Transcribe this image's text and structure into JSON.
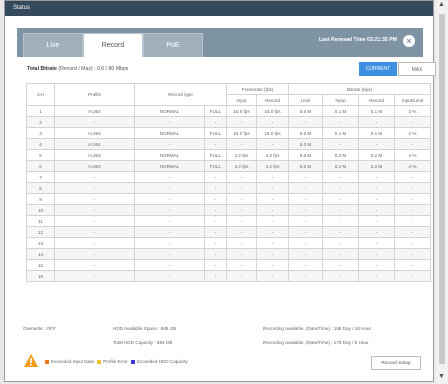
{
  "window": {
    "title": "Status"
  },
  "tabs": [
    {
      "label": "Live"
    },
    {
      "label": "Record"
    },
    {
      "label": "PoE"
    }
  ],
  "header": {
    "last_time": "Last Renewal Time 03:21:35 PM",
    "close_icon": "close-icon",
    "tab_bg_color": "#7e94a3"
  },
  "bitrate": {
    "label": "Total Bitrate",
    "detail": "(Record / Max) : 0.6 / 80 Mbps"
  },
  "toggle": {
    "current": "CURRENT",
    "max": "MAX",
    "accent": "#3d8fe0"
  },
  "table": {
    "headers": {
      "ch": "CH",
      "profile": "Profile",
      "record_type": "Record type",
      "framerate": "Framerate (fps)",
      "bitrate": "Bitrate (bps)",
      "input": "Input",
      "record": "Record",
      "limit": "Limit",
      "input_b": "Input",
      "record_b": "Record",
      "input_limit": "Input/Limit"
    },
    "rows": [
      [
        "1",
        "H.264",
        "NORMAL",
        "FULL",
        "15.0 fps",
        "15.0 fps",
        "5.0 M",
        "0.1 M",
        "0.1 M",
        "2 %"
      ],
      [
        "2",
        "-",
        "-",
        "-",
        "-",
        "-",
        "-",
        "-",
        "-",
        "-"
      ],
      [
        "3",
        "H.264",
        "NORMAL",
        "FULL",
        "15.0 fps",
        "15.0 fps",
        "5.0 M",
        "0.1 M",
        "0.1 M",
        "2 %"
      ],
      [
        "4",
        "H.264",
        "-",
        "-",
        "-",
        "-",
        "5.0 M",
        "-",
        "-",
        "-"
      ],
      [
        "5",
        "H.264",
        "NORMAL",
        "FULL",
        "4.2 fps",
        "4.2 fps",
        "5.0 M",
        "0.2 M",
        "0.2 M",
        "4 %"
      ],
      [
        "6",
        "H.264",
        "NORMAL",
        "FULL",
        "4.2 fps",
        "4.2 fps",
        "5.0 M",
        "0.2 M",
        "0.2 M",
        "4 %"
      ],
      [
        "7",
        "-",
        "-",
        "-",
        "-",
        "-",
        "-",
        "-",
        "-",
        "-"
      ],
      [
        "8",
        "-",
        "-",
        "-",
        "-",
        "-",
        "-",
        "-",
        "-",
        "-"
      ],
      [
        "9",
        "-",
        "-",
        "-",
        "-",
        "-",
        "-",
        "-",
        "-",
        "-"
      ],
      [
        "10",
        "-",
        "-",
        "-",
        "-",
        "-",
        "-",
        "-",
        "-",
        "-"
      ],
      [
        "11",
        "-",
        "-",
        "-",
        "-",
        "-",
        "-",
        "-",
        "-",
        "-"
      ],
      [
        "12",
        "-",
        "-",
        "-",
        "-",
        "-",
        "-",
        "-",
        "-",
        "-"
      ],
      [
        "13",
        "-",
        "-",
        "-",
        "-",
        "-",
        "-",
        "-",
        "-",
        "-"
      ],
      [
        "14",
        "-",
        "-",
        "-",
        "-",
        "-",
        "-",
        "-",
        "-",
        "-"
      ],
      [
        "15",
        "-",
        "-",
        "-",
        "-",
        "-",
        "-",
        "-",
        "-",
        "-"
      ],
      [
        "16",
        "-",
        "-",
        "-",
        "-",
        "-",
        "-",
        "-",
        "-",
        "-"
      ]
    ]
  },
  "info": {
    "overwrite": "Overwrite : OFF",
    "hdd_space": "HDD Available Space : 885 GB",
    "hdd_capacity": "Total HDD Capacity : 894 GB",
    "rec_avail_1": "Recording available. (Date/Time) : 158 Day / 16 Hour",
    "rec_avail_2": "Recording available. (Date/Time) : 178 Day / 5 Hour"
  },
  "legend": {
    "exceeded_input": "Exceeded Input Data",
    "profile_error": "Profile Error",
    "exceeded_hdd": "Exceeded HDD Capacity",
    "colors": {
      "exceeded_input": "#f07b1e",
      "profile_error": "#f2c12e",
      "exceeded_hdd": "#3a3ad0"
    },
    "warning_icon": "warning-icon"
  },
  "buttons": {
    "record_setup": "Record Setup"
  }
}
